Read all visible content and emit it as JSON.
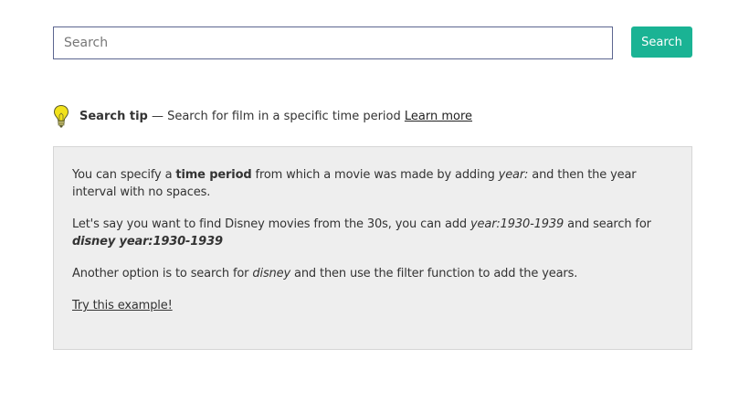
{
  "search": {
    "placeholder": "Search",
    "value": "",
    "button_label": "Search",
    "button_color": "#1ab394"
  },
  "tip": {
    "icon": "lightbulb-icon",
    "heading": "Search tip",
    "separator": " — ",
    "summary": "Search for film in a specific time period",
    "learn_more": "Learn more"
  },
  "details": {
    "p1": {
      "a": "You can specify a ",
      "b_bold": "time period",
      "c": " from which a movie was made by adding ",
      "d_italic": "year:",
      "e": " and then the year interval with no spaces."
    },
    "p2": {
      "a": "Let's say you want to find Disney movies from the 30s, you can add ",
      "b_italic": "year:1930-1939",
      "c": " and search for ",
      "d_bold_italic": "disney year:1930-1939"
    },
    "p3": {
      "a": "Another option is to search for ",
      "b_italic": "disney",
      "c": " and then use the filter function to add the years."
    },
    "try_example": "Try this example!"
  }
}
